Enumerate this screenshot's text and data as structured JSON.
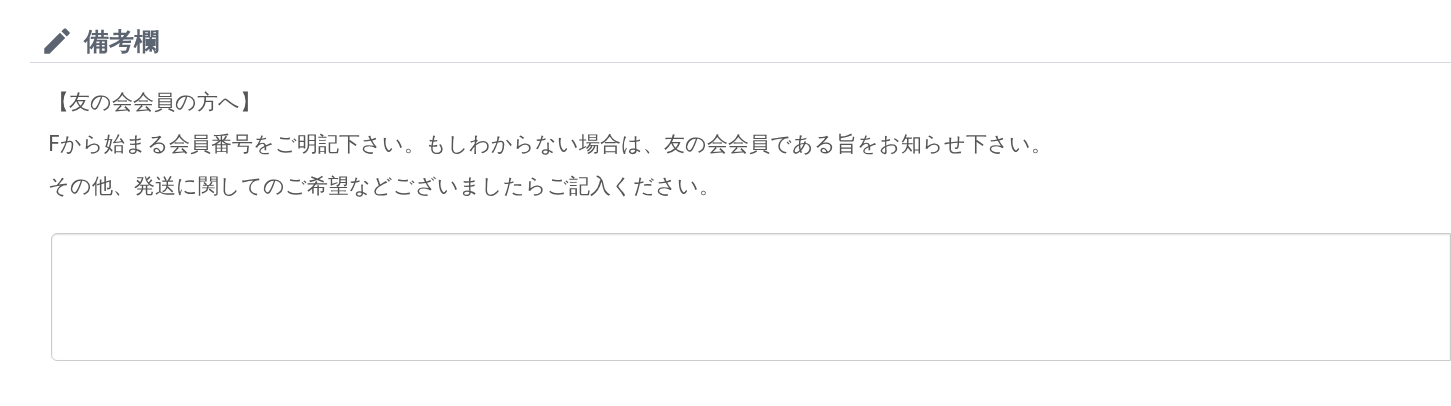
{
  "section": {
    "title": "備考欄"
  },
  "instructions": [
    "【友の会会員の方へ】",
    "Fから始まる会員番号をご明記下さい。もしわからない場合は、友の会会員である旨をお知らせ下さい。",
    "その他、発送に関してのご希望などございましたらご記入ください。"
  ],
  "remarks_field": {
    "kind": "textarea"
  }
}
